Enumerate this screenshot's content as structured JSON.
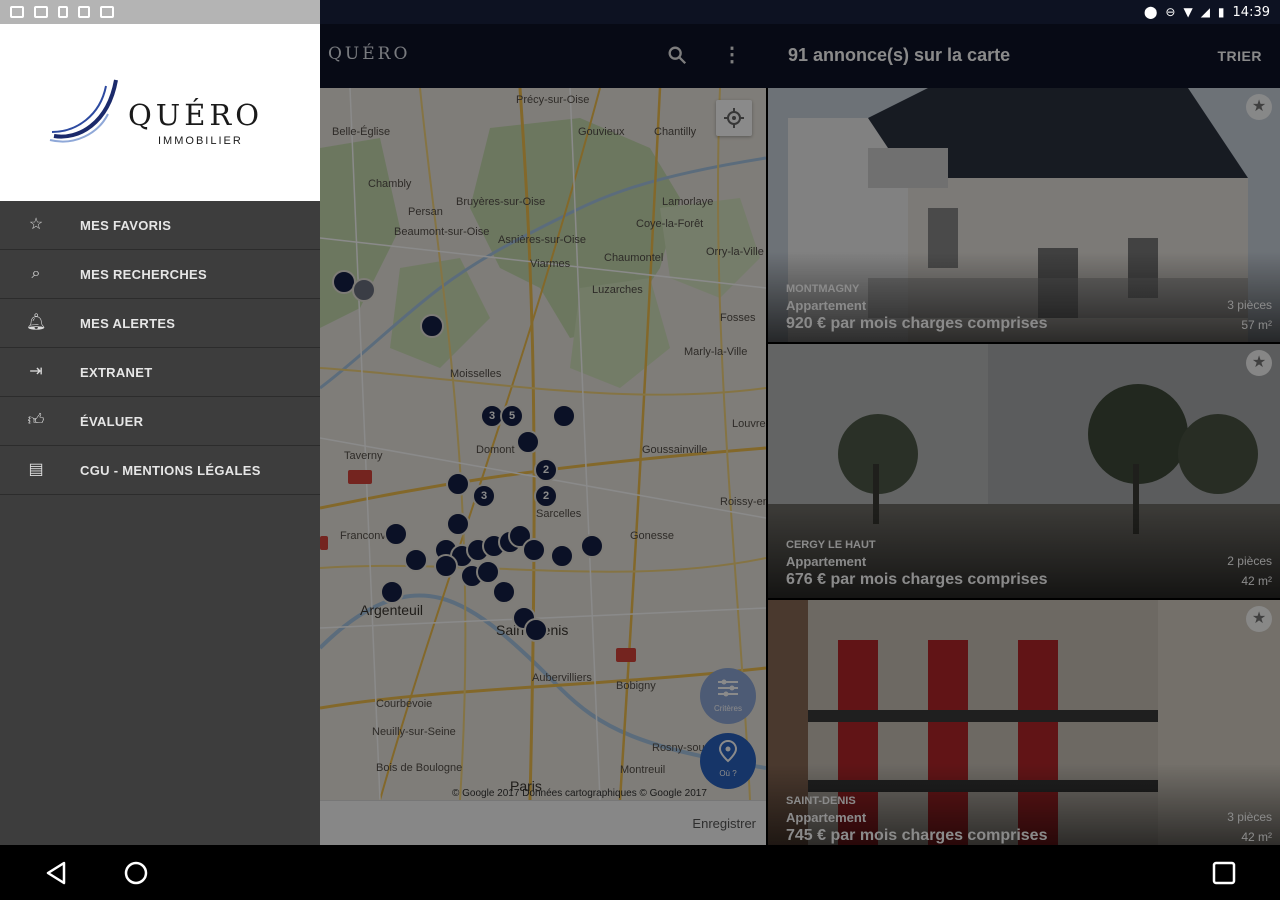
{
  "status_bar": {
    "time": "14:39"
  },
  "appbar": {
    "logo_text": "QUÉRO"
  },
  "list_header": {
    "title": "91 annonce(s) sur la carte",
    "sort_label": "TRIER"
  },
  "drawer": {
    "brand_name": "QUÉRO",
    "brand_sub": "IMMOBILIER",
    "items": [
      {
        "icon": "star-icon",
        "label": "MES FAVORIS"
      },
      {
        "icon": "search-list-icon",
        "label": "MES RECHERCHES"
      },
      {
        "icon": "bell-icon",
        "label": "MES ALERTES"
      },
      {
        "icon": "login-icon",
        "label": "EXTRANET"
      },
      {
        "icon": "thumbs-up-icon",
        "label": "ÉVALUER"
      },
      {
        "icon": "clipboard-icon",
        "label": "CGU - MENTIONS LÉGALES"
      }
    ]
  },
  "map": {
    "places": [
      "Précy-sur-Oise",
      "Belle-Église",
      "Gouvieux",
      "Chantilly",
      "Chambly",
      "Lamorlaye",
      "Persan",
      "Bruyères-sur-Oise",
      "Coye-la-Forêt",
      "Beaumont-sur-Oise",
      "Asnières-sur-Oise",
      "Orry-la-Ville",
      "Viarmes",
      "Chaumontel",
      "Luzarches",
      "Fosses",
      "Marly-la-Ville",
      "Moisselles",
      "Taverny",
      "Domont",
      "Goussainville",
      "Louvres",
      "Roissy-en-France",
      "Sarcelles",
      "Franconville",
      "Gonesse",
      "Argenteuil",
      "Saint-Denis",
      "Aubervilliers",
      "Bobigny",
      "Courbevoie",
      "Neuilly-sur-Seine",
      "Rosny-sous-Bois",
      "Bois de Boulogne",
      "Paris",
      "Montreuil"
    ],
    "cluster_labels": [
      "3",
      "5",
      "2",
      "2",
      "3"
    ],
    "copyright": "© Google 2017 Données cartographiques © Google 2017",
    "filter_label": "Critères",
    "pin_label": "Où ?",
    "save_label": "Enregistrer"
  },
  "listings": [
    {
      "city": "MONTMAGNY",
      "type": "Appartement",
      "price": "920 € par mois charges comprises",
      "rooms": "3 pièces",
      "area": "57 m²"
    },
    {
      "city": "CERGY LE HAUT",
      "type": "Appartement",
      "price": "676 € par mois charges comprises",
      "rooms": "2 pièces",
      "area": "42 m²"
    },
    {
      "city": "SAINT-DENIS",
      "type": "Appartement",
      "price": "745 € par mois charges comprises",
      "rooms": "3 pièces",
      "area": "42 m²"
    }
  ],
  "colors": {
    "appbar": "#0e1428",
    "drawer": "#3d3d3d",
    "marker": "#152046",
    "fab_pin": "#2a63c0"
  }
}
